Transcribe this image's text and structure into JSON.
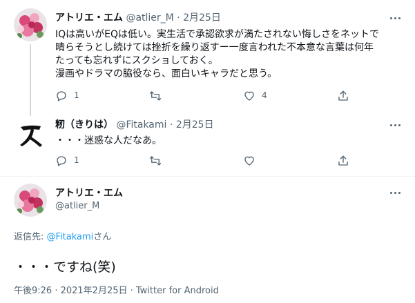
{
  "tweets": [
    {
      "display_name": "アトリエ・エム",
      "handle": "@atlier_M",
      "separator": "·",
      "date": "2月25日",
      "text": "IQは高いがEQは低い。実生活で承認欲求が満たされない悔しさをネットで\n晴らそうとし続けては挫折を繰り返すー一度言われた不本意な言葉は何年\nたっても忘れずにスクショしておく。\n漫画やドラマの脇役なら、面白いキャラだと思う。",
      "reply_count": "1",
      "retweet_count": "",
      "like_count": "4"
    },
    {
      "display_name": "籾（きりは）",
      "handle": "@Fitakami",
      "separator": "·",
      "date": "2月25日",
      "text": "・・・迷惑な人だなあ。",
      "reply_count": "1",
      "retweet_count": "",
      "like_count": ""
    }
  ],
  "main_tweet": {
    "display_name": "アトリエ・エム",
    "handle": "@atlier_M",
    "reply_to_prefix": "返信先: ",
    "reply_to_handle": "@Fitakami",
    "reply_to_suffix": "さん",
    "text": "・・・ですね(笑)",
    "timestamp": "午後9:26 · 2021年2月25日 · Twitter for Android"
  },
  "colors": {
    "accent": "#1d9bf0",
    "secondary_text": "#536471",
    "divider": "#eff3f4"
  },
  "icons": [
    "reply-icon",
    "retweet-icon",
    "like-icon",
    "share-icon",
    "more-icon"
  ]
}
